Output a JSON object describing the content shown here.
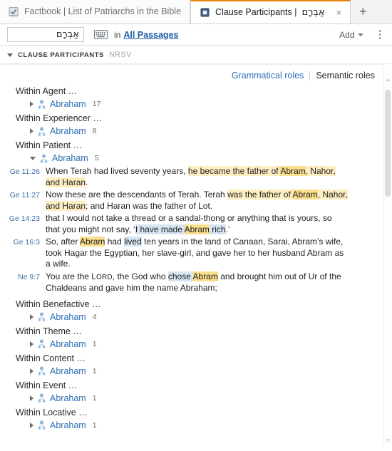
{
  "tabs": [
    {
      "label": "Factbook | List of Patriarchs in the Bible",
      "icon": "factbook-icon",
      "active": false
    },
    {
      "label": "Clause Participants | ",
      "hebrew": "אַבְרָם",
      "icon": "clause-participants-icon",
      "active": true,
      "close": "×"
    }
  ],
  "newtab_label": "+",
  "search": {
    "query": "אַבְרָם",
    "keyboard_icon": "keyboard-icon",
    "in_label": "in",
    "scope": "All Passages"
  },
  "toolbar": {
    "add_label": "Add",
    "menu_icon": "vertical-dots-icon"
  },
  "panel": {
    "title": "CLAUSE PARTICIPANTS",
    "version": "NRSV",
    "collapse_icon": "triangle-down-icon"
  },
  "roles": {
    "grammatical": "Grammatical roles",
    "semantic": "Semantic roles"
  },
  "groups": [
    {
      "header": "Within Agent …",
      "expanded": false,
      "entity": {
        "name": "Abraham",
        "count": "17",
        "icon": "person-icon"
      },
      "verses": []
    },
    {
      "header": "Within Experiencer …",
      "expanded": false,
      "entity": {
        "name": "Abraham",
        "count": "8",
        "icon": "person-icon"
      },
      "verses": []
    },
    {
      "header": "Within Patient …",
      "expanded": true,
      "entity": {
        "name": "Abraham",
        "count": "5",
        "icon": "person-icon"
      },
      "verses": [
        {
          "ref": "Ge 11:26",
          "parts": [
            {
              "t": "When Terah had lived seventy years, ",
              "h": "none"
            },
            {
              "t": "he became the father of ",
              "h": "yellow"
            },
            {
              "t": "Abram",
              "h": "yellow-strong"
            },
            {
              "t": ", Nahor, and Haran",
              "h": "yellow"
            },
            {
              "t": ".",
              "h": "none"
            }
          ]
        },
        {
          "ref": "Ge 11:27",
          "parts": [
            {
              "t": "Now these are the descendants of Terah. Terah ",
              "h": "none"
            },
            {
              "t": "was the father of ",
              "h": "yellow"
            },
            {
              "t": "Abram",
              "h": "yellow-strong"
            },
            {
              "t": ", Nahor, and Haran",
              "h": "yellow"
            },
            {
              "t": "; and Haran was the father of Lot.",
              "h": "none"
            }
          ]
        },
        {
          "ref": "Ge 14:23",
          "parts": [
            {
              "t": "that I would not take a thread or a sandal-thong or anything that is yours, so that you might not say, ‘",
              "h": "none"
            },
            {
              "t": "I have made ",
              "h": "blue"
            },
            {
              "t": "Abram",
              "h": "yellow-strong"
            },
            {
              "t": " rich",
              "h": "blue"
            },
            {
              "t": ".’",
              "h": "none"
            }
          ]
        },
        {
          "ref": "Ge 16:3",
          "parts": [
            {
              "t": "So, after ",
              "h": "none"
            },
            {
              "t": "Abram",
              "h": "yellow-strong"
            },
            {
              "t": " had ",
              "h": "none"
            },
            {
              "t": "lived",
              "h": "blue"
            },
            {
              "t": " ten years in the land of Canaan, Sarai, Abram’s wife, took Hagar the Egyptian, her slave-girl, and gave her to her husband Abram as a wife.",
              "h": "none"
            }
          ]
        },
        {
          "ref": "Ne 9:7",
          "parts": [
            {
              "t": "You are the ",
              "h": "none"
            },
            {
              "t": "Lord",
              "h": "smallcaps"
            },
            {
              "t": ", the God who ",
              "h": "none"
            },
            {
              "t": "chose ",
              "h": "blue"
            },
            {
              "t": "Abram",
              "h": "yellow-strong"
            },
            {
              "t": " and brought him out of Ur of the Chaldeans and gave him the name Abraham;",
              "h": "none"
            }
          ]
        }
      ]
    },
    {
      "header": "Within Benefactive …",
      "expanded": false,
      "entity": {
        "name": "Abraham",
        "count": "4",
        "icon": "person-icon"
      },
      "verses": []
    },
    {
      "header": "Within Theme …",
      "expanded": false,
      "entity": {
        "name": "Abraham",
        "count": "1",
        "icon": "person-icon"
      },
      "verses": []
    },
    {
      "header": "Within Content …",
      "expanded": false,
      "entity": {
        "name": "Abraham",
        "count": "1",
        "icon": "person-icon"
      },
      "verses": []
    },
    {
      "header": "Within Event …",
      "expanded": false,
      "entity": {
        "name": "Abraham",
        "count": "1",
        "icon": "person-icon"
      },
      "verses": []
    },
    {
      "header": "Within Locative …",
      "expanded": false,
      "entity": {
        "name": "Abraham",
        "count": "1",
        "icon": "person-icon"
      },
      "verses": []
    }
  ],
  "scrollbar": {
    "up_icon": "scroll-up-arrow-icon",
    "down_icon": "scroll-down-arrow-icon"
  },
  "colors": {
    "accent_orange": "#e8820c",
    "link_blue": "#2f6fb5",
    "highlight_yellow": "#fdeec2",
    "highlight_yellow_strong": "#fcdf8e",
    "highlight_blue": "#d7e4f2"
  }
}
